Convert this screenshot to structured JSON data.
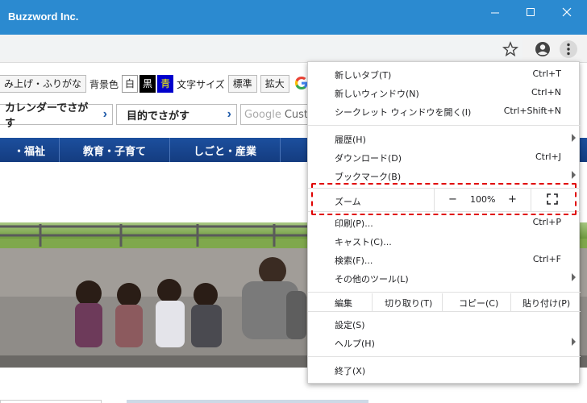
{
  "window": {
    "title": "Buzzword Inc.",
    "controls": [
      "minimize-icon",
      "maximize-icon",
      "close-icon"
    ]
  },
  "toolbar": {
    "icons": [
      "star-icon",
      "account-icon",
      "more-vert-icon"
    ]
  },
  "page": {
    "a11y": {
      "read_aloud": "み上げ・ふりがな",
      "bg_color_label": "背景色",
      "bg_white": "白",
      "bg_black": "黒",
      "bg_blue": "青",
      "font_size_label": "文字サイズ",
      "size_standard": "標準",
      "size_large": "拡大"
    },
    "search": {
      "calendar_button": "カレンダーでさがす",
      "purpose_button": "目的でさがす",
      "google_placeholder": "Google",
      "custom_text": "Custo"
    },
    "nav": [
      "・福祉",
      "教育・子育て",
      "しごと・産業",
      ""
    ]
  },
  "menu": {
    "items": [
      {
        "label": "新しいタブ(T)",
        "shortcut": "Ctrl+T"
      },
      {
        "label": "新しいウィンドウ(N)",
        "shortcut": "Ctrl+N"
      },
      {
        "label": "シークレット ウィンドウを開く(I)",
        "shortcut": "Ctrl+Shift+N"
      },
      {
        "label": "履歴(H)",
        "shortcut": ""
      },
      {
        "label": "ダウンロード(D)",
        "shortcut": "Ctrl+J"
      },
      {
        "label": "ブックマーク(B)",
        "shortcut": ""
      },
      {
        "label": "印刷(P)...",
        "shortcut": "Ctrl+P"
      },
      {
        "label": "キャスト(C)...",
        "shortcut": ""
      },
      {
        "label": "検索(F)...",
        "shortcut": "Ctrl+F"
      },
      {
        "label": "その他のツール(L)",
        "shortcut": ""
      },
      {
        "label": "設定(S)",
        "shortcut": ""
      },
      {
        "label": "ヘルプ(H)",
        "shortcut": ""
      },
      {
        "label": "終了(X)",
        "shortcut": ""
      }
    ],
    "zoom": {
      "label": "ズーム",
      "minus": "−",
      "value": "100%",
      "plus": "+"
    },
    "edit": {
      "label": "編集",
      "cut": "切り取り(T)",
      "copy": "コピー(C)",
      "paste": "貼り付け(P)"
    }
  },
  "colors": {
    "titlebar": "#2b8ad0",
    "nav": "#1c4f9e",
    "highlight": "#e00000"
  }
}
